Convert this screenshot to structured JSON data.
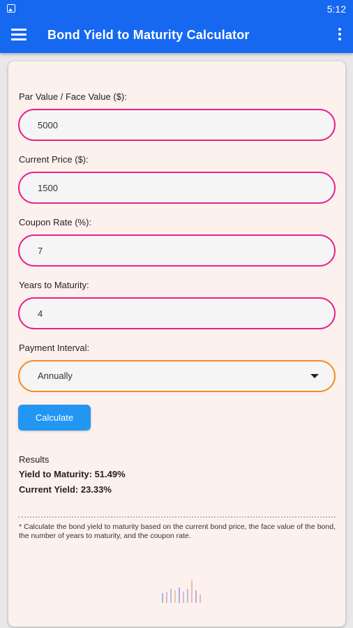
{
  "status_bar": {
    "time": "5:12"
  },
  "app_bar": {
    "title": "Bond Yield to Maturity Calculator"
  },
  "form": {
    "par_value": {
      "label": "Par Value / Face Value ($):",
      "value": "5000"
    },
    "current_price": {
      "label": "Current Price ($):",
      "value": "1500"
    },
    "coupon_rate": {
      "label": "Coupon Rate (%):",
      "value": "7"
    },
    "years_to_maturity": {
      "label": "Years to Maturity:",
      "value": "4"
    },
    "payment_interval": {
      "label": "Payment Interval:",
      "selected": "Annually"
    },
    "calculate_label": "Calculate"
  },
  "results": {
    "heading": "Results",
    "ytm": "Yield to Maturity: 51.49%",
    "current_yield": "Current Yield: 23.33%"
  },
  "footnote": "* Calculate the bond yield to maturity based on the current bond price, the face value of the bond, the number of years to maturity, and the coupon rate.",
  "colors": {
    "primary": "#1768f0",
    "input_border": "#e8228a",
    "select_border": "#f38b2a",
    "button": "#2196f3",
    "card_bg": "#fdf1ee"
  },
  "icons": [
    "image-notification-icon",
    "menu-icon",
    "more-vert-icon",
    "dropdown-caret-icon",
    "logo-bars-icon"
  ]
}
